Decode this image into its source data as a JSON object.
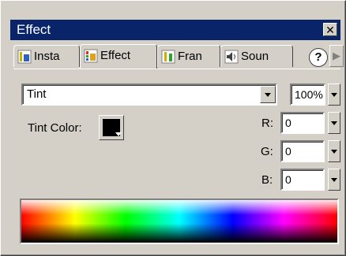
{
  "window": {
    "title": "Effect",
    "close_glyph": "✕"
  },
  "tabs": [
    {
      "label": "Insta",
      "icon": "instance-icon",
      "active": false
    },
    {
      "label": "Effect",
      "icon": "effect-icon",
      "active": true
    },
    {
      "label": "Fran",
      "icon": "frame-icon",
      "active": false
    },
    {
      "label": "Soun",
      "icon": "sound-icon",
      "active": false
    }
  ],
  "help_label": "?",
  "tab_scroll_glyph": "▶",
  "effect": {
    "selected": "Tint",
    "amount": "100%",
    "tint_color_label": "Tint Color:",
    "tint_color": "#000000",
    "r_label": "R:",
    "r_value": "0",
    "g_label": "G:",
    "g_value": "0",
    "b_label": "B:",
    "b_value": "0"
  },
  "colors": {
    "titlebar": "#0a246a",
    "face": "#d4d0c8"
  }
}
